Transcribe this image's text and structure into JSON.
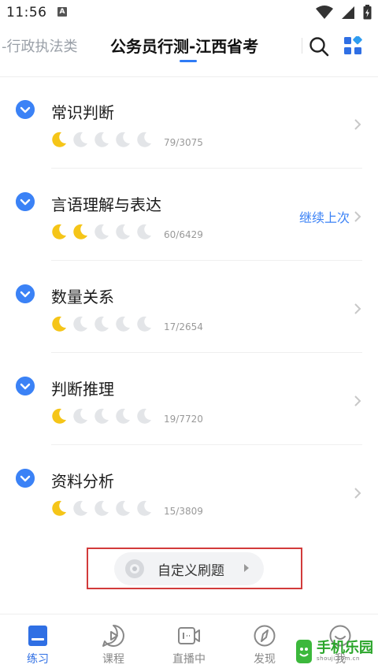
{
  "status": {
    "time": "11:56",
    "app_icon_letter": "A"
  },
  "nav": {
    "left_tab": "-行政执法类",
    "title": "公务员行测-江西省考",
    "accent": "#2f7bf5"
  },
  "items": [
    {
      "title": "常识判断",
      "moons_filled": 1,
      "moons_total": 5,
      "count": "79/3075",
      "continue": ""
    },
    {
      "title": "言语理解与表达",
      "moons_filled": 2,
      "moons_total": 5,
      "count": "60/6429",
      "continue": "继续上次"
    },
    {
      "title": "数量关系",
      "moons_filled": 1,
      "moons_total": 5,
      "count": "17/2654",
      "continue": ""
    },
    {
      "title": "判断推理",
      "moons_filled": 1,
      "moons_total": 5,
      "count": "19/7720",
      "continue": ""
    },
    {
      "title": "资料分析",
      "moons_filled": 1,
      "moons_total": 5,
      "count": "15/3809",
      "continue": ""
    }
  ],
  "custom": {
    "label": "自定义刷题"
  },
  "tabs": [
    {
      "label": "练习",
      "icon": "book-icon",
      "active": true
    },
    {
      "label": "课程",
      "icon": "play-icon",
      "active": false
    },
    {
      "label": "直播中",
      "icon": "live-icon",
      "active": false
    },
    {
      "label": "发现",
      "icon": "compass-icon",
      "active": false
    },
    {
      "label": "我",
      "icon": "smile-icon",
      "active": false
    }
  ],
  "watermark": {
    "text": "手机乐园",
    "sub": "shouji.com.cn"
  },
  "colors": {
    "accent": "#3b82f6",
    "moon_filled": "#f5c518",
    "moon_empty": "#e3e5e8",
    "highlight_border": "#d23b3b"
  }
}
